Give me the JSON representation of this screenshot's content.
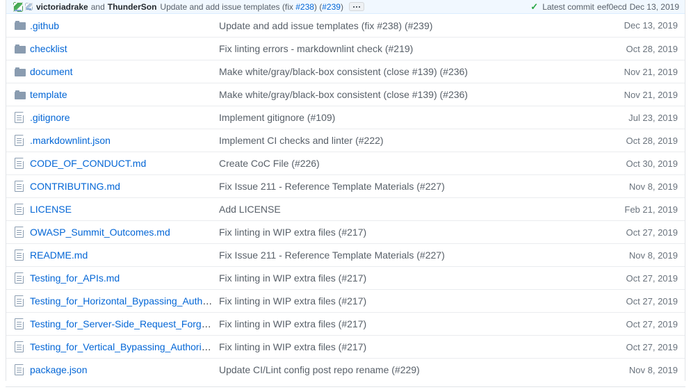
{
  "commit_header": {
    "author_primary": "victoriadrake",
    "conjunction": "and",
    "author_secondary": "ThunderSon",
    "message_prefix": "Update and add issue templates (",
    "message_abbr": "fix",
    "message_space": " ",
    "issue_link_1": "#238",
    "message_middle": ") (",
    "issue_link_2": "#239",
    "message_suffix": ")",
    "more_button": "…",
    "check_icon": "check-icon",
    "latest_label": "Latest commit",
    "commit_sha": "eef0ecd",
    "commit_date": "Dec 13, 2019"
  },
  "files": [
    {
      "icon": "folder-icon",
      "type": "directory",
      "name": ".github",
      "message_pre": "Update and add issue templates (",
      "message_abbr": "fix",
      "message_post": " #238) (#239)",
      "date": "Dec 13, 2019"
    },
    {
      "icon": "folder-icon",
      "type": "directory",
      "name": "checklist",
      "message_pre": "Fix linting errors - markdownlint check (#219)",
      "message_abbr": "",
      "message_post": "",
      "date": "Oct 28, 2019"
    },
    {
      "icon": "folder-icon",
      "type": "directory",
      "name": "document",
      "message_pre": "Make white/gray/black-box consistent (",
      "message_abbr": "close",
      "message_post": " #139) (#236)",
      "date": "Nov 21, 2019"
    },
    {
      "icon": "folder-icon",
      "type": "directory",
      "name": "template",
      "message_pre": "Make white/gray/black-box consistent (",
      "message_abbr": "close",
      "message_post": " #139) (#236)",
      "date": "Nov 21, 2019"
    },
    {
      "icon": "file-icon",
      "type": "file",
      "name": ".gitignore",
      "message_pre": "Implement gitignore (#109)",
      "message_abbr": "",
      "message_post": "",
      "date": "Jul 23, 2019"
    },
    {
      "icon": "file-icon",
      "type": "file",
      "name": ".markdownlint.json",
      "message_pre": "Implement CI checks and linter (#222)",
      "message_abbr": "",
      "message_post": "",
      "date": "Oct 28, 2019"
    },
    {
      "icon": "file-icon",
      "type": "file",
      "name": "CODE_OF_CONDUCT.md",
      "message_pre": "Create CoC File (#226)",
      "message_abbr": "",
      "message_post": "",
      "date": "Oct 30, 2019"
    },
    {
      "icon": "file-icon",
      "type": "file",
      "name": "CONTRIBUTING.md",
      "message_pre": "Fix Issue 211 - Reference Template Materials (#227)",
      "message_abbr": "",
      "message_post": "",
      "date": "Nov 8, 2019"
    },
    {
      "icon": "file-icon",
      "type": "file",
      "name": "LICENSE",
      "message_pre": "Add LICENSE",
      "message_abbr": "",
      "message_post": "",
      "date": "Feb 21, 2019"
    },
    {
      "icon": "file-icon",
      "type": "file",
      "name": "OWASP_Summit_Outcomes.md",
      "message_pre": "Fix linting in WIP extra files (#217)",
      "message_abbr": "",
      "message_post": "",
      "date": "Oct 27, 2019"
    },
    {
      "icon": "file-icon",
      "type": "file",
      "name": "README.md",
      "message_pre": "Fix Issue 211 - Reference Template Materials (#227)",
      "message_abbr": "",
      "message_post": "",
      "date": "Nov 8, 2019"
    },
    {
      "icon": "file-icon",
      "type": "file",
      "name": "Testing_for_APIs.md",
      "message_pre": "Fix linting in WIP extra files (#217)",
      "message_abbr": "",
      "message_post": "",
      "date": "Oct 27, 2019"
    },
    {
      "icon": "file-icon",
      "type": "file",
      "name": "Testing_for_Horizontal_Bypassing_Author…",
      "message_pre": "Fix linting in WIP extra files (#217)",
      "message_abbr": "",
      "message_post": "",
      "date": "Oct 27, 2019"
    },
    {
      "icon": "file-icon",
      "type": "file",
      "name": "Testing_for_Server-Side_Request_Forgery…",
      "message_pre": "Fix linting in WIP extra files (#217)",
      "message_abbr": "",
      "message_post": "",
      "date": "Oct 27, 2019"
    },
    {
      "icon": "file-icon",
      "type": "file",
      "name": "Testing_for_Vertical_Bypassing_Authoriza…",
      "message_pre": "Fix linting in WIP extra files (#217)",
      "message_abbr": "",
      "message_post": "",
      "date": "Oct 27, 2019"
    },
    {
      "icon": "file-icon",
      "type": "file",
      "name": "package.json",
      "message_pre": "Update CI/Lint config post repo rename (#229)",
      "message_abbr": "",
      "message_post": "",
      "date": "Nov 8, 2019"
    }
  ],
  "colors": {
    "link": "#0366d6",
    "muted": "#586069",
    "border": "#e1e4e8",
    "header_bg": "#f1f8ff",
    "success": "#28a745"
  }
}
